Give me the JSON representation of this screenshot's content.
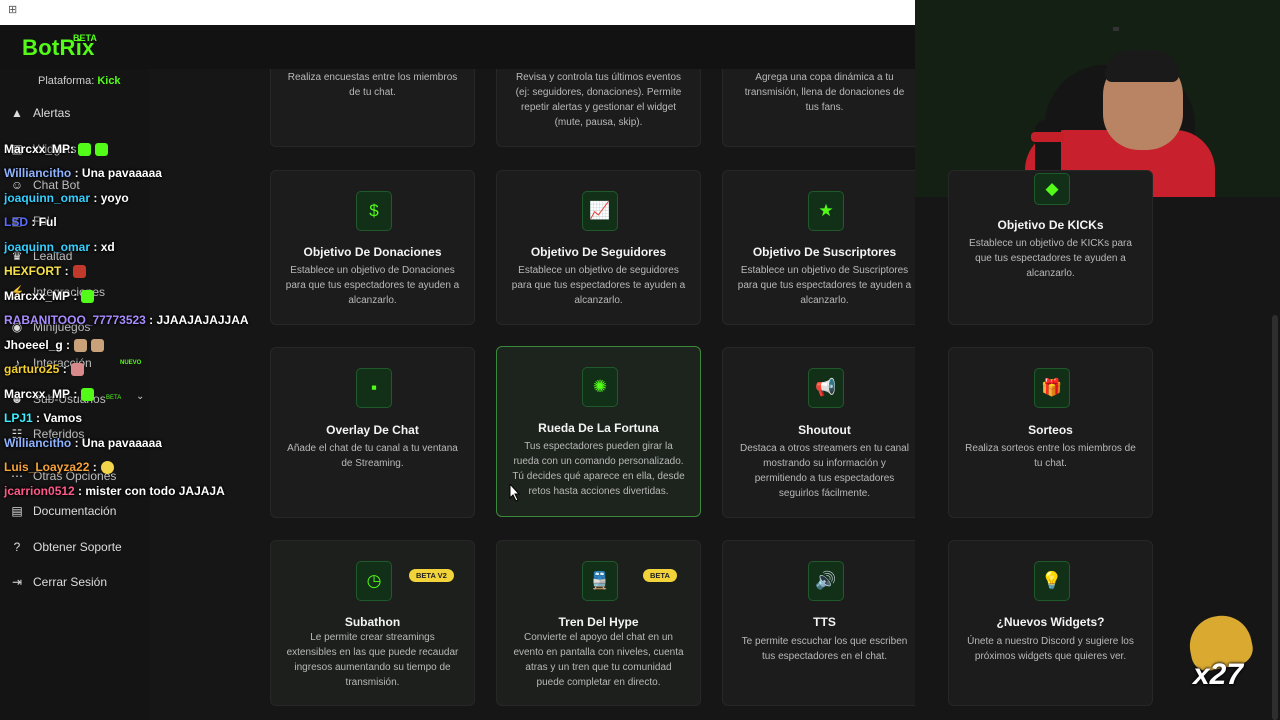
{
  "header": {
    "logo": "BotRix",
    "logo_badge": "BETA"
  },
  "sidebar": {
    "platform_label": "Plataforma:",
    "platform_value": "Kick",
    "items": [
      {
        "label": "Alertas",
        "icon": "warning-icon"
      },
      {
        "label": "Widgets",
        "icon": "widgets-icon"
      },
      {
        "label": "Chat Bot",
        "icon": "robot-icon"
      },
      {
        "label": "Ful",
        "icon": "fill-icon"
      },
      {
        "label": "Lealtad",
        "icon": "trophy-icon"
      },
      {
        "label": "Integraciones",
        "icon": "plug-icon"
      },
      {
        "label": "Minijuegos",
        "icon": "gamepad-icon"
      },
      {
        "label": "Interacción",
        "icon": "music-icon",
        "badge": "NUEVO"
      },
      {
        "label": "Sub-Usuarios",
        "icon": "users-icon",
        "badge": "BETA"
      },
      {
        "label": "Referidos",
        "icon": "people-icon"
      },
      {
        "label": "Otras Opciones",
        "icon": "dots-icon"
      },
      {
        "label": "Documentación",
        "icon": "document-icon"
      },
      {
        "label": "Obtener Soporte",
        "icon": "help-icon"
      },
      {
        "label": "Cerrar Sesión",
        "icon": "logout-icon"
      }
    ]
  },
  "cards": [
    {
      "title": "",
      "desc": "Realiza encuestas entre los miembros de tu chat.",
      "icon": "poll-icon"
    },
    {
      "title": "",
      "desc": "Revisa y controla tus últimos eventos (ej: seguidores, donaciones). Permite repetir alertas y gestionar el widget (mute, pausa, skip).",
      "icon": "events-icon"
    },
    {
      "title": "",
      "desc": "Agrega una copa dinámica a tu transmisión, llena de donaciones de tus fans.",
      "icon": "cup-icon"
    },
    {
      "title": "Objetivo De Donaciones",
      "desc": "Establece un objetivo de Donaciones para que tus espectadores te ayuden a alcanzarlo.",
      "icon": "dollar-icon",
      "glyph": "$"
    },
    {
      "title": "Objetivo De Seguidores",
      "desc": "Establece un objetivo de seguidores para que tus espectadores te ayuden a alcanzarlo.",
      "icon": "chart-line-icon",
      "glyph": "📈"
    },
    {
      "title": "Objetivo De Suscriptores",
      "desc": "Establece un objetivo de Suscriptores para que tus espectadores te ayuden a alcanzarlo.",
      "icon": "star-icon",
      "glyph": "★"
    },
    {
      "title": "Objetivo De KICKs",
      "desc": "Establece un objetivo de KICKs para que tus espectadores te ayuden a alcanzarlo.",
      "icon": "gem-icon",
      "glyph": "◆"
    },
    {
      "title": "Overlay De Chat",
      "desc": "Añade el chat de tu canal a tu ventana de Streaming.",
      "icon": "chat-bubble-icon",
      "glyph": "▪"
    },
    {
      "title": "Rueda De La Fortuna",
      "desc": "Tus espectadores pueden girar la rueda con un comando personalizado. Tú decides qué aparece en ella, desde retos hasta acciones divertidas.",
      "icon": "wheel-icon",
      "glyph": "✺"
    },
    {
      "title": "Shoutout",
      "desc": "Destaca a otros streamers en tu canal mostrando su información y permitiendo a tus espectadores seguirlos fácilmente.",
      "icon": "megaphone-icon",
      "glyph": "📢"
    },
    {
      "title": "Sorteos",
      "desc": "Realiza sorteos entre los miembros de tu chat.",
      "icon": "gift-icon",
      "glyph": "🎁"
    },
    {
      "title": "Subathon",
      "desc": "Le permite crear streamings extensibles en las que puede recaudar ingresos aumentando su tiempo de transmisión.",
      "icon": "clock-icon",
      "glyph": "◷",
      "badge": "BETA V2"
    },
    {
      "title": "Tren Del Hype",
      "desc": "Convierte el apoyo del chat en un evento en pantalla con niveles, cuenta atras y un tren que tu comunidad puede completar en directo.",
      "icon": "train-icon",
      "glyph": "🚆",
      "badge": "BETA"
    },
    {
      "title": "TTS",
      "desc": "Te permite escuchar los que escriben tus espectadores en el chat.",
      "icon": "speaker-icon",
      "glyph": "🔊"
    },
    {
      "title": "¿Nuevos Widgets?",
      "desc": "Únete a nuestro Discord y sugiere los próximos widgets que quieres ver.",
      "icon": "lightbulb-icon",
      "glyph": "💡"
    }
  ],
  "chat": [
    {
      "user": "Marcxx_MP",
      "msg": "",
      "color": "#ffffff"
    },
    {
      "user": "Williancitho",
      "msg": "Una pavaaaaa",
      "color": "#8fb3ff"
    },
    {
      "user": "joaquinn_omar",
      "msg": "yoyo",
      "color": "#35d0ff"
    },
    {
      "user": "LSD",
      "msg": "Ful",
      "color": "#5a6cff"
    },
    {
      "user": "joaquinn_omar",
      "msg": "xd",
      "color": "#35d0ff"
    },
    {
      "user": "HEXFORT",
      "msg": "",
      "color": "#f5e14a"
    },
    {
      "user": "Marcxx_MP",
      "msg": "",
      "color": "#ffffff"
    },
    {
      "user": "RABANITOOO_77773523",
      "msg": "JJAAJAJAJJAA",
      "color": "#a98cff"
    },
    {
      "user": "Jhoeeel_g",
      "msg": "",
      "color": "#ffffff"
    },
    {
      "user": "garturo25",
      "msg": "",
      "color": "#f6d22e"
    },
    {
      "user": "Marcxx_MP",
      "msg": "",
      "color": "#ffffff"
    },
    {
      "user": "LPJ1",
      "msg": "Vamos",
      "color": "#3af0ff"
    },
    {
      "user": "Williancitho",
      "msg": "Una pavaaaaa",
      "color": "#8fb3ff"
    },
    {
      "user": "Luis_Loayza22",
      "msg": "",
      "color": "#f6a33a"
    },
    {
      "user": "jcarrion0512",
      "msg": "mister con todo JAJAJA",
      "color": "#ff5a8a"
    }
  ],
  "reward": {
    "count": "x27"
  }
}
